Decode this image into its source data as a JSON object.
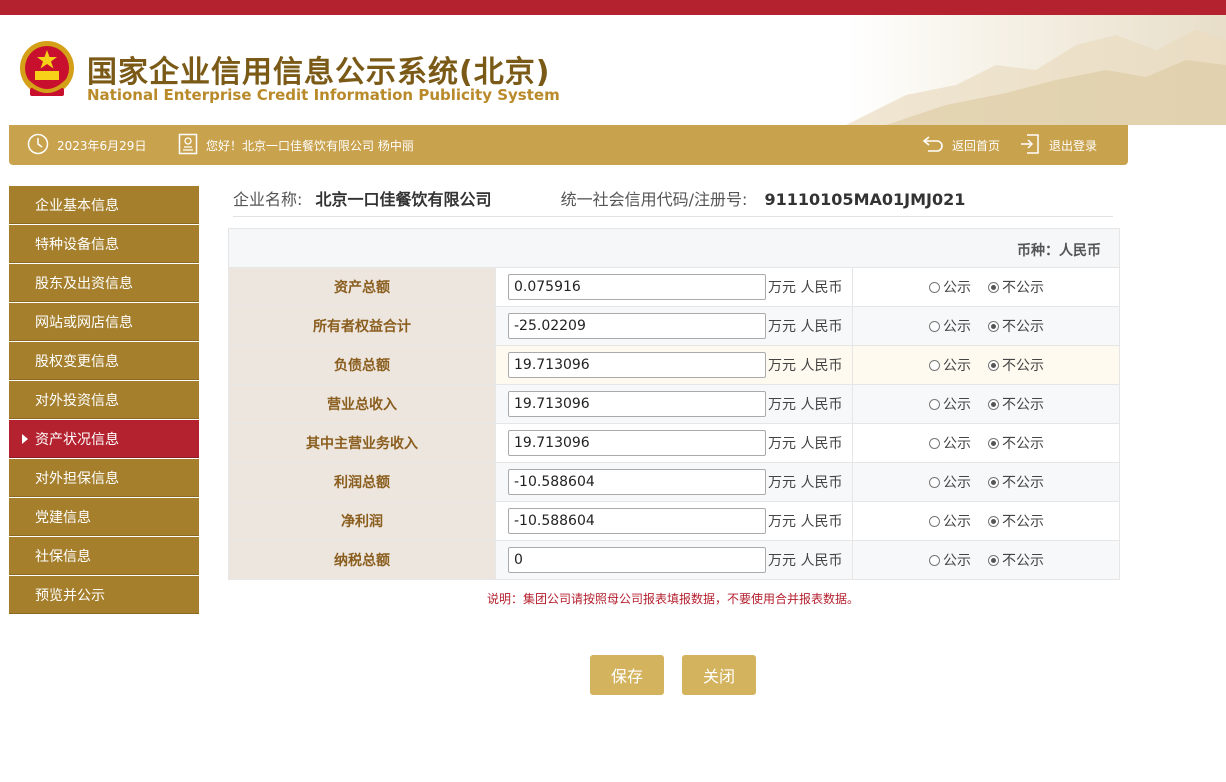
{
  "header": {
    "title_cn": "国家企业信用信息公示系统(北京)",
    "title_en": "National Enterprise Credit Information Publicity System"
  },
  "infobar": {
    "date": "2023年6月29日",
    "greeting": "您好！北京一口佳餐饮有限公司  杨中丽",
    "home_label": "返回首页",
    "logout_label": "退出登录"
  },
  "sidebar": {
    "items": [
      {
        "label": "企业基本信息"
      },
      {
        "label": "特种设备信息"
      },
      {
        "label": "股东及出资信息"
      },
      {
        "label": "网站或网店信息"
      },
      {
        "label": "股权变更信息"
      },
      {
        "label": "对外投资信息"
      },
      {
        "label": "资产状况信息"
      },
      {
        "label": "对外担保信息"
      },
      {
        "label": "党建信息"
      },
      {
        "label": "社保信息"
      },
      {
        "label": "预览并公示"
      }
    ],
    "active_index": 6
  },
  "company": {
    "name_label": "企业名称:",
    "name_value": "北京一口佳餐饮有限公司",
    "code_label": "统一社会信用代码/注册号:",
    "code_value": "91110105MA01JMJ021"
  },
  "table": {
    "currency": "币种：人民币",
    "unit": "万元 人民币",
    "option_public": "公示",
    "option_private": "不公示",
    "rows": [
      {
        "label": "资产总额",
        "value": "0.075916"
      },
      {
        "label": "所有者权益合计",
        "value": "-25.02209"
      },
      {
        "label": "负债总额",
        "value": "19.713096"
      },
      {
        "label": "营业总收入",
        "value": "19.713096"
      },
      {
        "label": "其中主营业务收入",
        "value": "19.713096"
      },
      {
        "label": "利润总额",
        "value": "-10.588604"
      },
      {
        "label": "净利润",
        "value": "-10.588604"
      },
      {
        "label": "纳税总额",
        "value": "0"
      }
    ]
  },
  "note": "说明：集团公司请按照母公司报表填报数据，不要使用合并报表数据。",
  "buttons": {
    "save": "保存",
    "close": "关闭"
  },
  "colors": {
    "brand_red": "#b4212f",
    "gold": "#c9a24d",
    "sidebar_gold": "#a57f2c"
  }
}
